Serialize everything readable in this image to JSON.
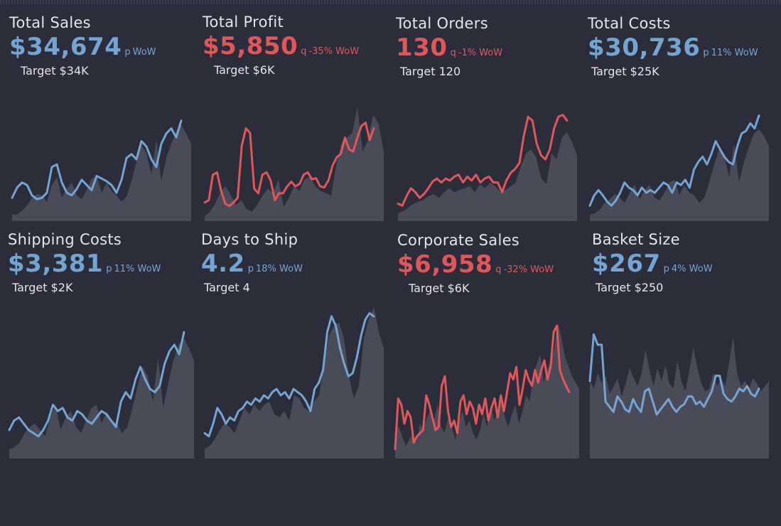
{
  "colors": {
    "background": "#2b2d3b",
    "up": "#74a4d2",
    "down": "#e15759",
    "area": "#4a4b58",
    "text": "#e4e4ea"
  },
  "kpis": [
    {
      "title": "Total Sales",
      "value": "$34,674",
      "arrow": "p",
      "wow": "WoW",
      "target": "Target $34K",
      "trend": "up",
      "series": [
        18,
        26,
        30,
        28,
        20,
        17,
        18,
        22,
        42,
        44,
        30,
        22,
        20,
        25,
        32,
        28,
        24,
        35,
        33,
        31,
        28,
        22,
        32,
        49,
        52,
        48,
        62,
        58,
        48,
        42,
        60,
        68,
        72,
        65,
        78
      ],
      "prior": [
        5,
        5,
        8,
        12,
        18,
        21,
        20,
        15,
        28,
        34,
        18,
        25,
        30,
        20,
        17,
        24,
        33,
        35,
        22,
        30,
        23,
        20,
        15,
        19,
        31,
        46,
        59,
        53,
        36,
        63,
        31,
        49,
        60,
        70,
        75,
        68,
        60
      ]
    },
    {
      "title": "Total Profit",
      "value": "$5,850",
      "arrow": "q",
      "wow": "-35% WoW",
      "target": "Target $6K",
      "trend": "down",
      "series": [
        16,
        18,
        40,
        42,
        26,
        15,
        13,
        16,
        20,
        65,
        80,
        76,
        28,
        24,
        40,
        42,
        35,
        18,
        24,
        24,
        30,
        34,
        30,
        32,
        40,
        42,
        36,
        37,
        30,
        29,
        35,
        48,
        55,
        58,
        72,
        62,
        60,
        72,
        82,
        85,
        70,
        80
      ],
      "prior": [
        4,
        8,
        15,
        25,
        30,
        22,
        14,
        18,
        10,
        8,
        14,
        22,
        28,
        24,
        36,
        12,
        20,
        30,
        26,
        36,
        38,
        30,
        26,
        24,
        22,
        48,
        68,
        72,
        76,
        98,
        60,
        70,
        92,
        84,
        60
      ],
      "ylim": [
        0,
        100
      ]
    },
    {
      "title": "Total Orders",
      "value": "130",
      "arrow": "q",
      "wow": "-1% WoW",
      "target": "Target 120",
      "trend": "down",
      "series": [
        18,
        16,
        26,
        34,
        30,
        24,
        28,
        34,
        41,
        44,
        40,
        44,
        42,
        46,
        48,
        40,
        46,
        42,
        48,
        40,
        44,
        46,
        40,
        40,
        30,
        42,
        50,
        54,
        60,
        88,
        108,
        104,
        80,
        68,
        64,
        74,
        96,
        108,
        110,
        104
      ],
      "prior": [
        8,
        10,
        14,
        18,
        20,
        22,
        26,
        28,
        24,
        30,
        34,
        30,
        32,
        34,
        36,
        30,
        38,
        34,
        40,
        36,
        30,
        32,
        36,
        40,
        56,
        70,
        74,
        66,
        44,
        38,
        70,
        64,
        86,
        92,
        82,
        68
      ],
      "ylim": [
        0,
        120
      ]
    },
    {
      "title": "Total Costs",
      "value": "$30,736",
      "arrow": "p",
      "wow": "11% WoW",
      "target": "Target $25K",
      "trend": "up",
      "series": [
        12,
        20,
        24,
        20,
        15,
        12,
        16,
        22,
        30,
        26,
        24,
        20,
        26,
        22,
        24,
        22,
        26,
        30,
        28,
        22,
        30,
        28,
        32,
        26,
        40,
        46,
        50,
        44,
        52,
        62,
        56,
        50,
        46,
        44,
        58,
        68,
        70,
        76,
        72,
        82
      ],
      "prior": [
        5,
        6,
        9,
        14,
        17,
        21,
        18,
        14,
        22,
        28,
        17,
        24,
        28,
        18,
        16,
        22,
        30,
        32,
        20,
        28,
        22,
        20,
        14,
        18,
        30,
        44,
        56,
        50,
        34,
        60,
        30,
        46,
        58,
        68,
        71,
        66,
        58
      ]
    },
    {
      "title": "Shipping Costs",
      "value": "$3,381",
      "arrow": "p",
      "wow": "11% WoW",
      "target": "Target $2K",
      "trend": "up",
      "series": [
        18,
        24,
        26,
        22,
        18,
        16,
        14,
        18,
        24,
        34,
        30,
        32,
        26,
        24,
        30,
        28,
        24,
        22,
        26,
        30,
        28,
        24,
        20,
        36,
        42,
        38,
        50,
        58,
        50,
        44,
        42,
        46,
        60,
        68,
        72,
        66,
        80
      ],
      "prior": [
        6,
        7,
        10,
        16,
        20,
        22,
        18,
        14,
        26,
        34,
        18,
        26,
        30,
        20,
        16,
        24,
        32,
        34,
        22,
        30,
        24,
        22,
        16,
        20,
        32,
        46,
        58,
        52,
        36,
        64,
        32,
        48,
        62,
        72,
        76,
        70,
        62
      ]
    },
    {
      "title": "Days to Ship",
      "value": "4.2",
      "arrow": "p",
      "wow": "18% WoW",
      "target": "Target 4",
      "trend": "up",
      "series": [
        16,
        14,
        22,
        32,
        28,
        22,
        26,
        24,
        30,
        32,
        36,
        34,
        38,
        36,
        40,
        38,
        42,
        44,
        40,
        42,
        38,
        44,
        42,
        40,
        36,
        30,
        44,
        48,
        56,
        80,
        90,
        84,
        70,
        60,
        52,
        54,
        64,
        78,
        88,
        92,
        90
      ],
      "prior": [
        6,
        8,
        12,
        18,
        22,
        20,
        16,
        24,
        32,
        28,
        34,
        30,
        34,
        36,
        28,
        26,
        30,
        24,
        40,
        38,
        32,
        30,
        36,
        40,
        60,
        78,
        84,
        86,
        76,
        52,
        38,
        46,
        76,
        88,
        96,
        80,
        70
      ]
    },
    {
      "title": "Corporate Sales",
      "value": "$6,958",
      "arrow": "q",
      "wow": "-32% WoW",
      "target": "Target $6K",
      "trend": "down",
      "series": [
        6,
        38,
        34,
        22,
        30,
        26,
        10,
        14,
        16,
        18,
        40,
        34,
        26,
        18,
        20,
        46,
        52,
        30,
        20,
        24,
        16,
        36,
        40,
        28,
        36,
        32,
        22,
        34,
        28,
        38,
        24,
        32,
        38,
        26,
        40,
        30,
        42,
        54,
        50,
        58,
        34,
        44,
        56,
        50,
        46,
        56,
        48,
        56,
        62,
        50,
        58,
        80,
        84,
        56,
        50,
        46,
        42
      ],
      "prior": [
        18,
        20,
        14,
        8,
        12,
        16,
        10,
        22,
        18,
        26,
        30,
        24,
        34,
        20,
        16,
        26,
        20,
        12,
        22,
        30,
        20,
        24,
        16,
        12,
        18,
        28,
        20,
        34,
        24,
        30,
        36,
        26,
        20,
        28,
        34,
        22,
        30,
        40,
        36,
        52,
        60,
        66,
        48,
        56,
        62,
        70,
        86,
        76,
        64,
        58,
        52,
        48,
        44
      ],
      "ylim": [
        0,
        90
      ]
    },
    {
      "title": "Basket Size",
      "value": "$267",
      "arrow": "p",
      "wow": "4% WoW",
      "target": "Target $250",
      "trend": "up",
      "series": [
        60,
        96,
        88,
        88,
        44,
        40,
        36,
        48,
        44,
        38,
        36,
        46,
        40,
        36,
        52,
        54,
        44,
        34,
        38,
        42,
        46,
        40,
        36,
        40,
        42,
        48,
        48,
        42,
        44,
        40,
        46,
        52,
        64,
        64,
        50,
        46,
        44,
        48,
        54,
        52,
        56,
        50,
        48,
        54
      ],
      "prior": [
        60,
        54,
        66,
        58,
        64,
        50,
        56,
        62,
        48,
        58,
        70,
        62,
        56,
        66,
        84,
        68,
        56,
        70,
        60,
        72,
        58,
        54,
        76,
        60,
        52,
        68,
        86,
        70,
        58,
        52,
        54,
        66,
        56,
        62,
        56,
        74,
        94,
        66,
        56,
        60,
        54,
        62,
        58,
        52,
        56,
        60
      ],
      "ylim": [
        0,
        110
      ]
    }
  ]
}
